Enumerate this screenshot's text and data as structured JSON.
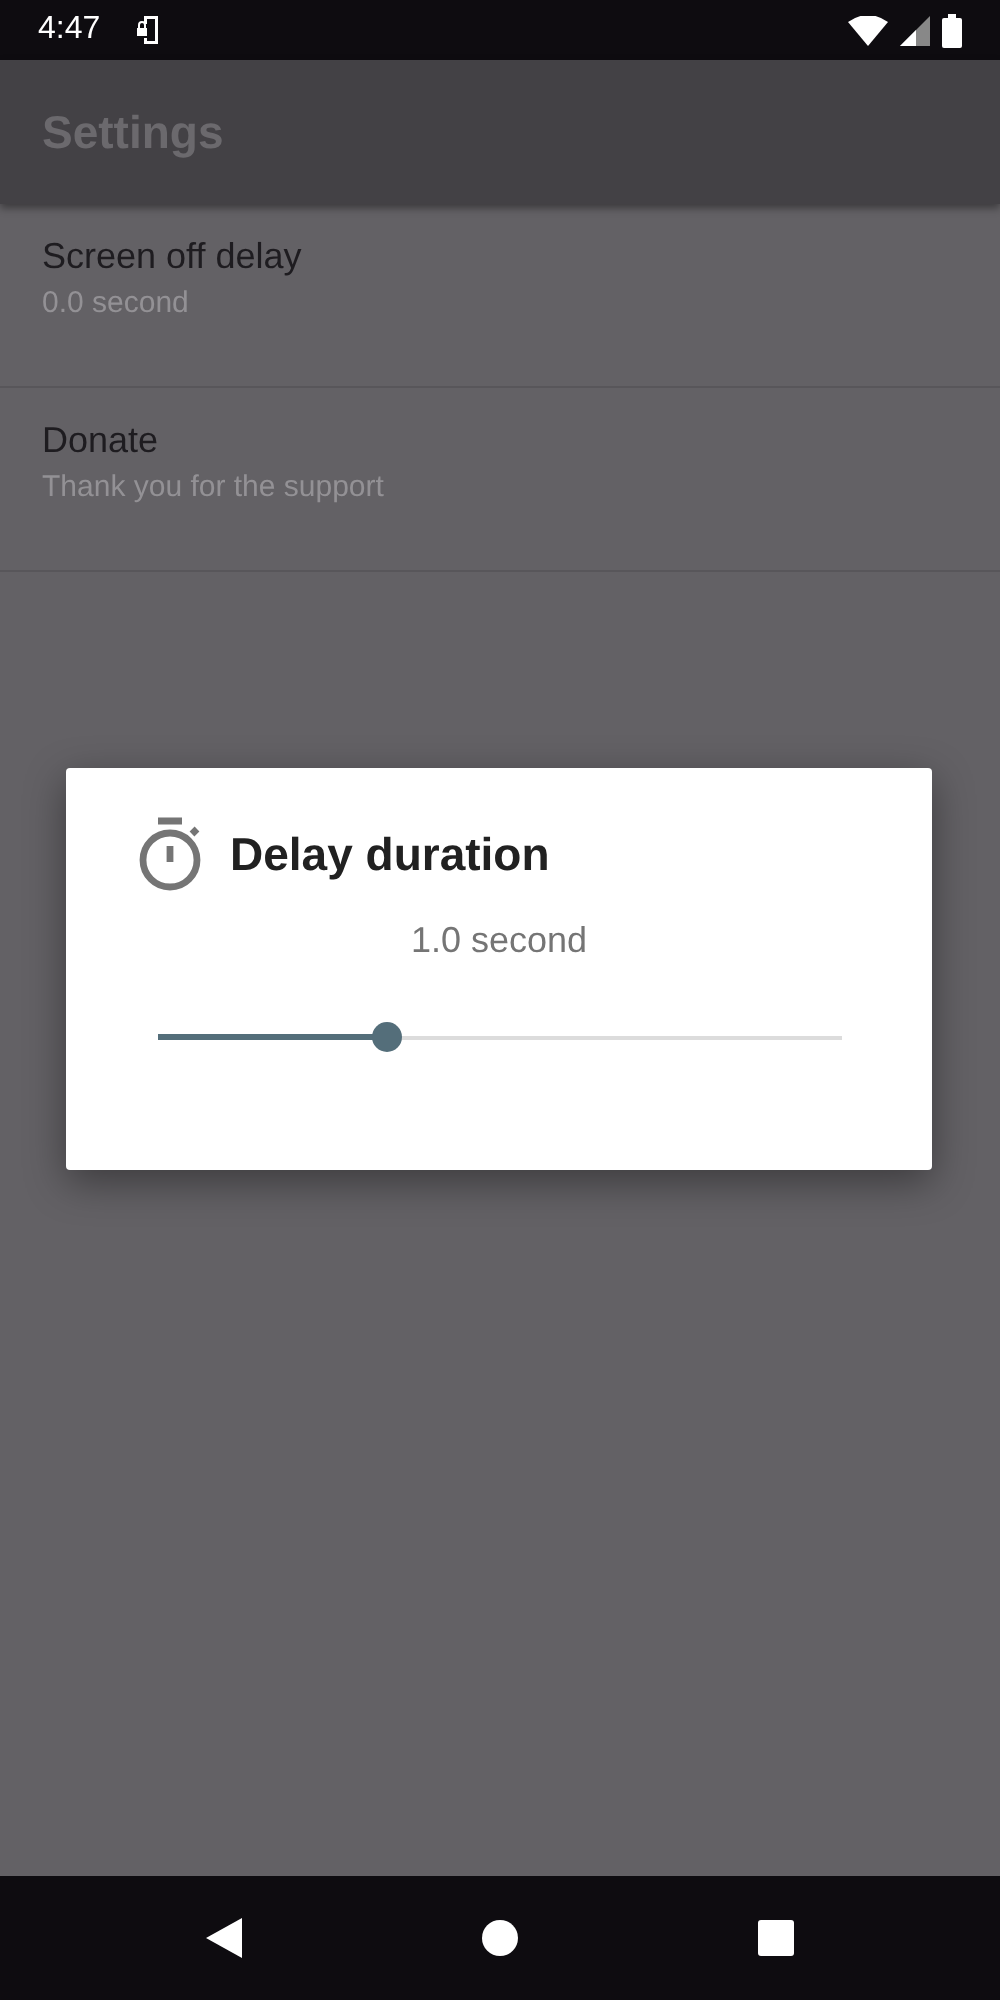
{
  "status_bar": {
    "time": "4:47"
  },
  "toolbar": {
    "title": "Settings"
  },
  "preferences": [
    {
      "title": "Screen off delay",
      "summary": "0.0 second"
    },
    {
      "title": "Donate",
      "summary": "Thank you for the support"
    }
  ],
  "dialog": {
    "title": "Delay duration",
    "value": "1.0 second",
    "slider": {
      "level": 0.333
    }
  }
}
